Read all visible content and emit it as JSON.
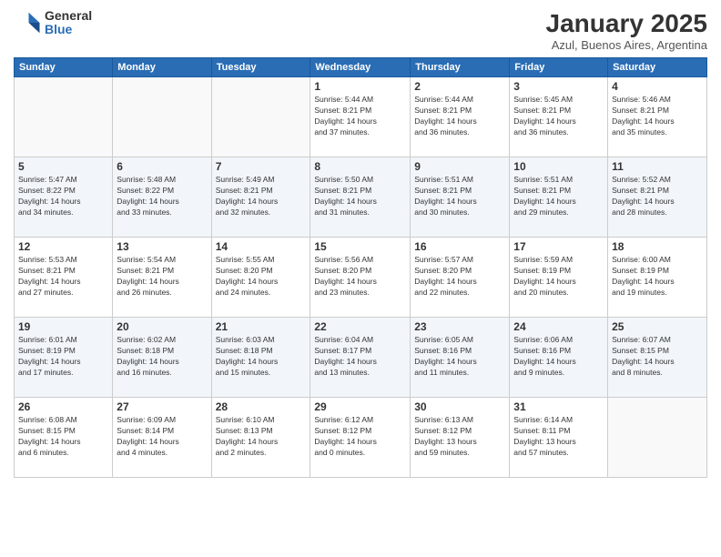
{
  "header": {
    "logo_general": "General",
    "logo_blue": "Blue",
    "month_title": "January 2025",
    "location": "Azul, Buenos Aires, Argentina"
  },
  "weekdays": [
    "Sunday",
    "Monday",
    "Tuesday",
    "Wednesday",
    "Thursday",
    "Friday",
    "Saturday"
  ],
  "weeks": [
    [
      {
        "day": "",
        "info": ""
      },
      {
        "day": "",
        "info": ""
      },
      {
        "day": "",
        "info": ""
      },
      {
        "day": "1",
        "info": "Sunrise: 5:44 AM\nSunset: 8:21 PM\nDaylight: 14 hours\nand 37 minutes."
      },
      {
        "day": "2",
        "info": "Sunrise: 5:44 AM\nSunset: 8:21 PM\nDaylight: 14 hours\nand 36 minutes."
      },
      {
        "day": "3",
        "info": "Sunrise: 5:45 AM\nSunset: 8:21 PM\nDaylight: 14 hours\nand 36 minutes."
      },
      {
        "day": "4",
        "info": "Sunrise: 5:46 AM\nSunset: 8:21 PM\nDaylight: 14 hours\nand 35 minutes."
      }
    ],
    [
      {
        "day": "5",
        "info": "Sunrise: 5:47 AM\nSunset: 8:22 PM\nDaylight: 14 hours\nand 34 minutes."
      },
      {
        "day": "6",
        "info": "Sunrise: 5:48 AM\nSunset: 8:22 PM\nDaylight: 14 hours\nand 33 minutes."
      },
      {
        "day": "7",
        "info": "Sunrise: 5:49 AM\nSunset: 8:21 PM\nDaylight: 14 hours\nand 32 minutes."
      },
      {
        "day": "8",
        "info": "Sunrise: 5:50 AM\nSunset: 8:21 PM\nDaylight: 14 hours\nand 31 minutes."
      },
      {
        "day": "9",
        "info": "Sunrise: 5:51 AM\nSunset: 8:21 PM\nDaylight: 14 hours\nand 30 minutes."
      },
      {
        "day": "10",
        "info": "Sunrise: 5:51 AM\nSunset: 8:21 PM\nDaylight: 14 hours\nand 29 minutes."
      },
      {
        "day": "11",
        "info": "Sunrise: 5:52 AM\nSunset: 8:21 PM\nDaylight: 14 hours\nand 28 minutes."
      }
    ],
    [
      {
        "day": "12",
        "info": "Sunrise: 5:53 AM\nSunset: 8:21 PM\nDaylight: 14 hours\nand 27 minutes."
      },
      {
        "day": "13",
        "info": "Sunrise: 5:54 AM\nSunset: 8:21 PM\nDaylight: 14 hours\nand 26 minutes."
      },
      {
        "day": "14",
        "info": "Sunrise: 5:55 AM\nSunset: 8:20 PM\nDaylight: 14 hours\nand 24 minutes."
      },
      {
        "day": "15",
        "info": "Sunrise: 5:56 AM\nSunset: 8:20 PM\nDaylight: 14 hours\nand 23 minutes."
      },
      {
        "day": "16",
        "info": "Sunrise: 5:57 AM\nSunset: 8:20 PM\nDaylight: 14 hours\nand 22 minutes."
      },
      {
        "day": "17",
        "info": "Sunrise: 5:59 AM\nSunset: 8:19 PM\nDaylight: 14 hours\nand 20 minutes."
      },
      {
        "day": "18",
        "info": "Sunrise: 6:00 AM\nSunset: 8:19 PM\nDaylight: 14 hours\nand 19 minutes."
      }
    ],
    [
      {
        "day": "19",
        "info": "Sunrise: 6:01 AM\nSunset: 8:19 PM\nDaylight: 14 hours\nand 17 minutes."
      },
      {
        "day": "20",
        "info": "Sunrise: 6:02 AM\nSunset: 8:18 PM\nDaylight: 14 hours\nand 16 minutes."
      },
      {
        "day": "21",
        "info": "Sunrise: 6:03 AM\nSunset: 8:18 PM\nDaylight: 14 hours\nand 15 minutes."
      },
      {
        "day": "22",
        "info": "Sunrise: 6:04 AM\nSunset: 8:17 PM\nDaylight: 14 hours\nand 13 minutes."
      },
      {
        "day": "23",
        "info": "Sunrise: 6:05 AM\nSunset: 8:16 PM\nDaylight: 14 hours\nand 11 minutes."
      },
      {
        "day": "24",
        "info": "Sunrise: 6:06 AM\nSunset: 8:16 PM\nDaylight: 14 hours\nand 9 minutes."
      },
      {
        "day": "25",
        "info": "Sunrise: 6:07 AM\nSunset: 8:15 PM\nDaylight: 14 hours\nand 8 minutes."
      }
    ],
    [
      {
        "day": "26",
        "info": "Sunrise: 6:08 AM\nSunset: 8:15 PM\nDaylight: 14 hours\nand 6 minutes."
      },
      {
        "day": "27",
        "info": "Sunrise: 6:09 AM\nSunset: 8:14 PM\nDaylight: 14 hours\nand 4 minutes."
      },
      {
        "day": "28",
        "info": "Sunrise: 6:10 AM\nSunset: 8:13 PM\nDaylight: 14 hours\nand 2 minutes."
      },
      {
        "day": "29",
        "info": "Sunrise: 6:12 AM\nSunset: 8:12 PM\nDaylight: 14 hours\nand 0 minutes."
      },
      {
        "day": "30",
        "info": "Sunrise: 6:13 AM\nSunset: 8:12 PM\nDaylight: 13 hours\nand 59 minutes."
      },
      {
        "day": "31",
        "info": "Sunrise: 6:14 AM\nSunset: 8:11 PM\nDaylight: 13 hours\nand 57 minutes."
      },
      {
        "day": "",
        "info": ""
      }
    ]
  ]
}
